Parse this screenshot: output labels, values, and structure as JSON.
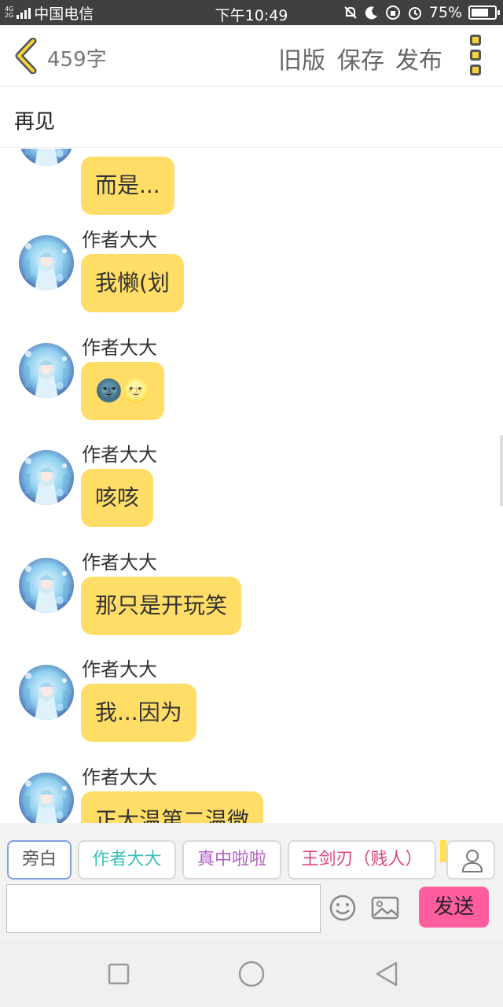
{
  "status_bar": {
    "network": "4G",
    "network2": "2G",
    "carrier": "中国电信",
    "time": "下午10:49",
    "battery": "75%",
    "battery_level": 0.75
  },
  "header": {
    "word_count": "459字",
    "old_version": "旧版",
    "save": "保存",
    "publish": "发布"
  },
  "chapter_title": "再见",
  "messages": [
    {
      "name": "",
      "text": "而是..."
    },
    {
      "name": "作者大大",
      "text": "我懒(划"
    },
    {
      "name": "作者大大",
      "text": "🌚🌝"
    },
    {
      "name": "作者大大",
      "text": "咳咳"
    },
    {
      "name": "作者大大",
      "text": "那只是开玩笑"
    },
    {
      "name": "作者大大",
      "text": "我...因为"
    },
    {
      "name": "作者大大",
      "text": "正大温第二温微"
    }
  ],
  "roles": [
    {
      "label": "旁白",
      "color": "#555555"
    },
    {
      "label": "作者大大",
      "color": "#3bbfb7"
    },
    {
      "label": "真中啦啦",
      "color": "#b15ec5"
    },
    {
      "label": "王剑刃（贱人）",
      "color": "#e0457b"
    }
  ],
  "composer": {
    "placeholder": "",
    "send_label": "发送"
  },
  "colors": {
    "bubble": "#ffdd66",
    "send": "#ff5e9e",
    "accent_yellow": "#f7d23c"
  }
}
